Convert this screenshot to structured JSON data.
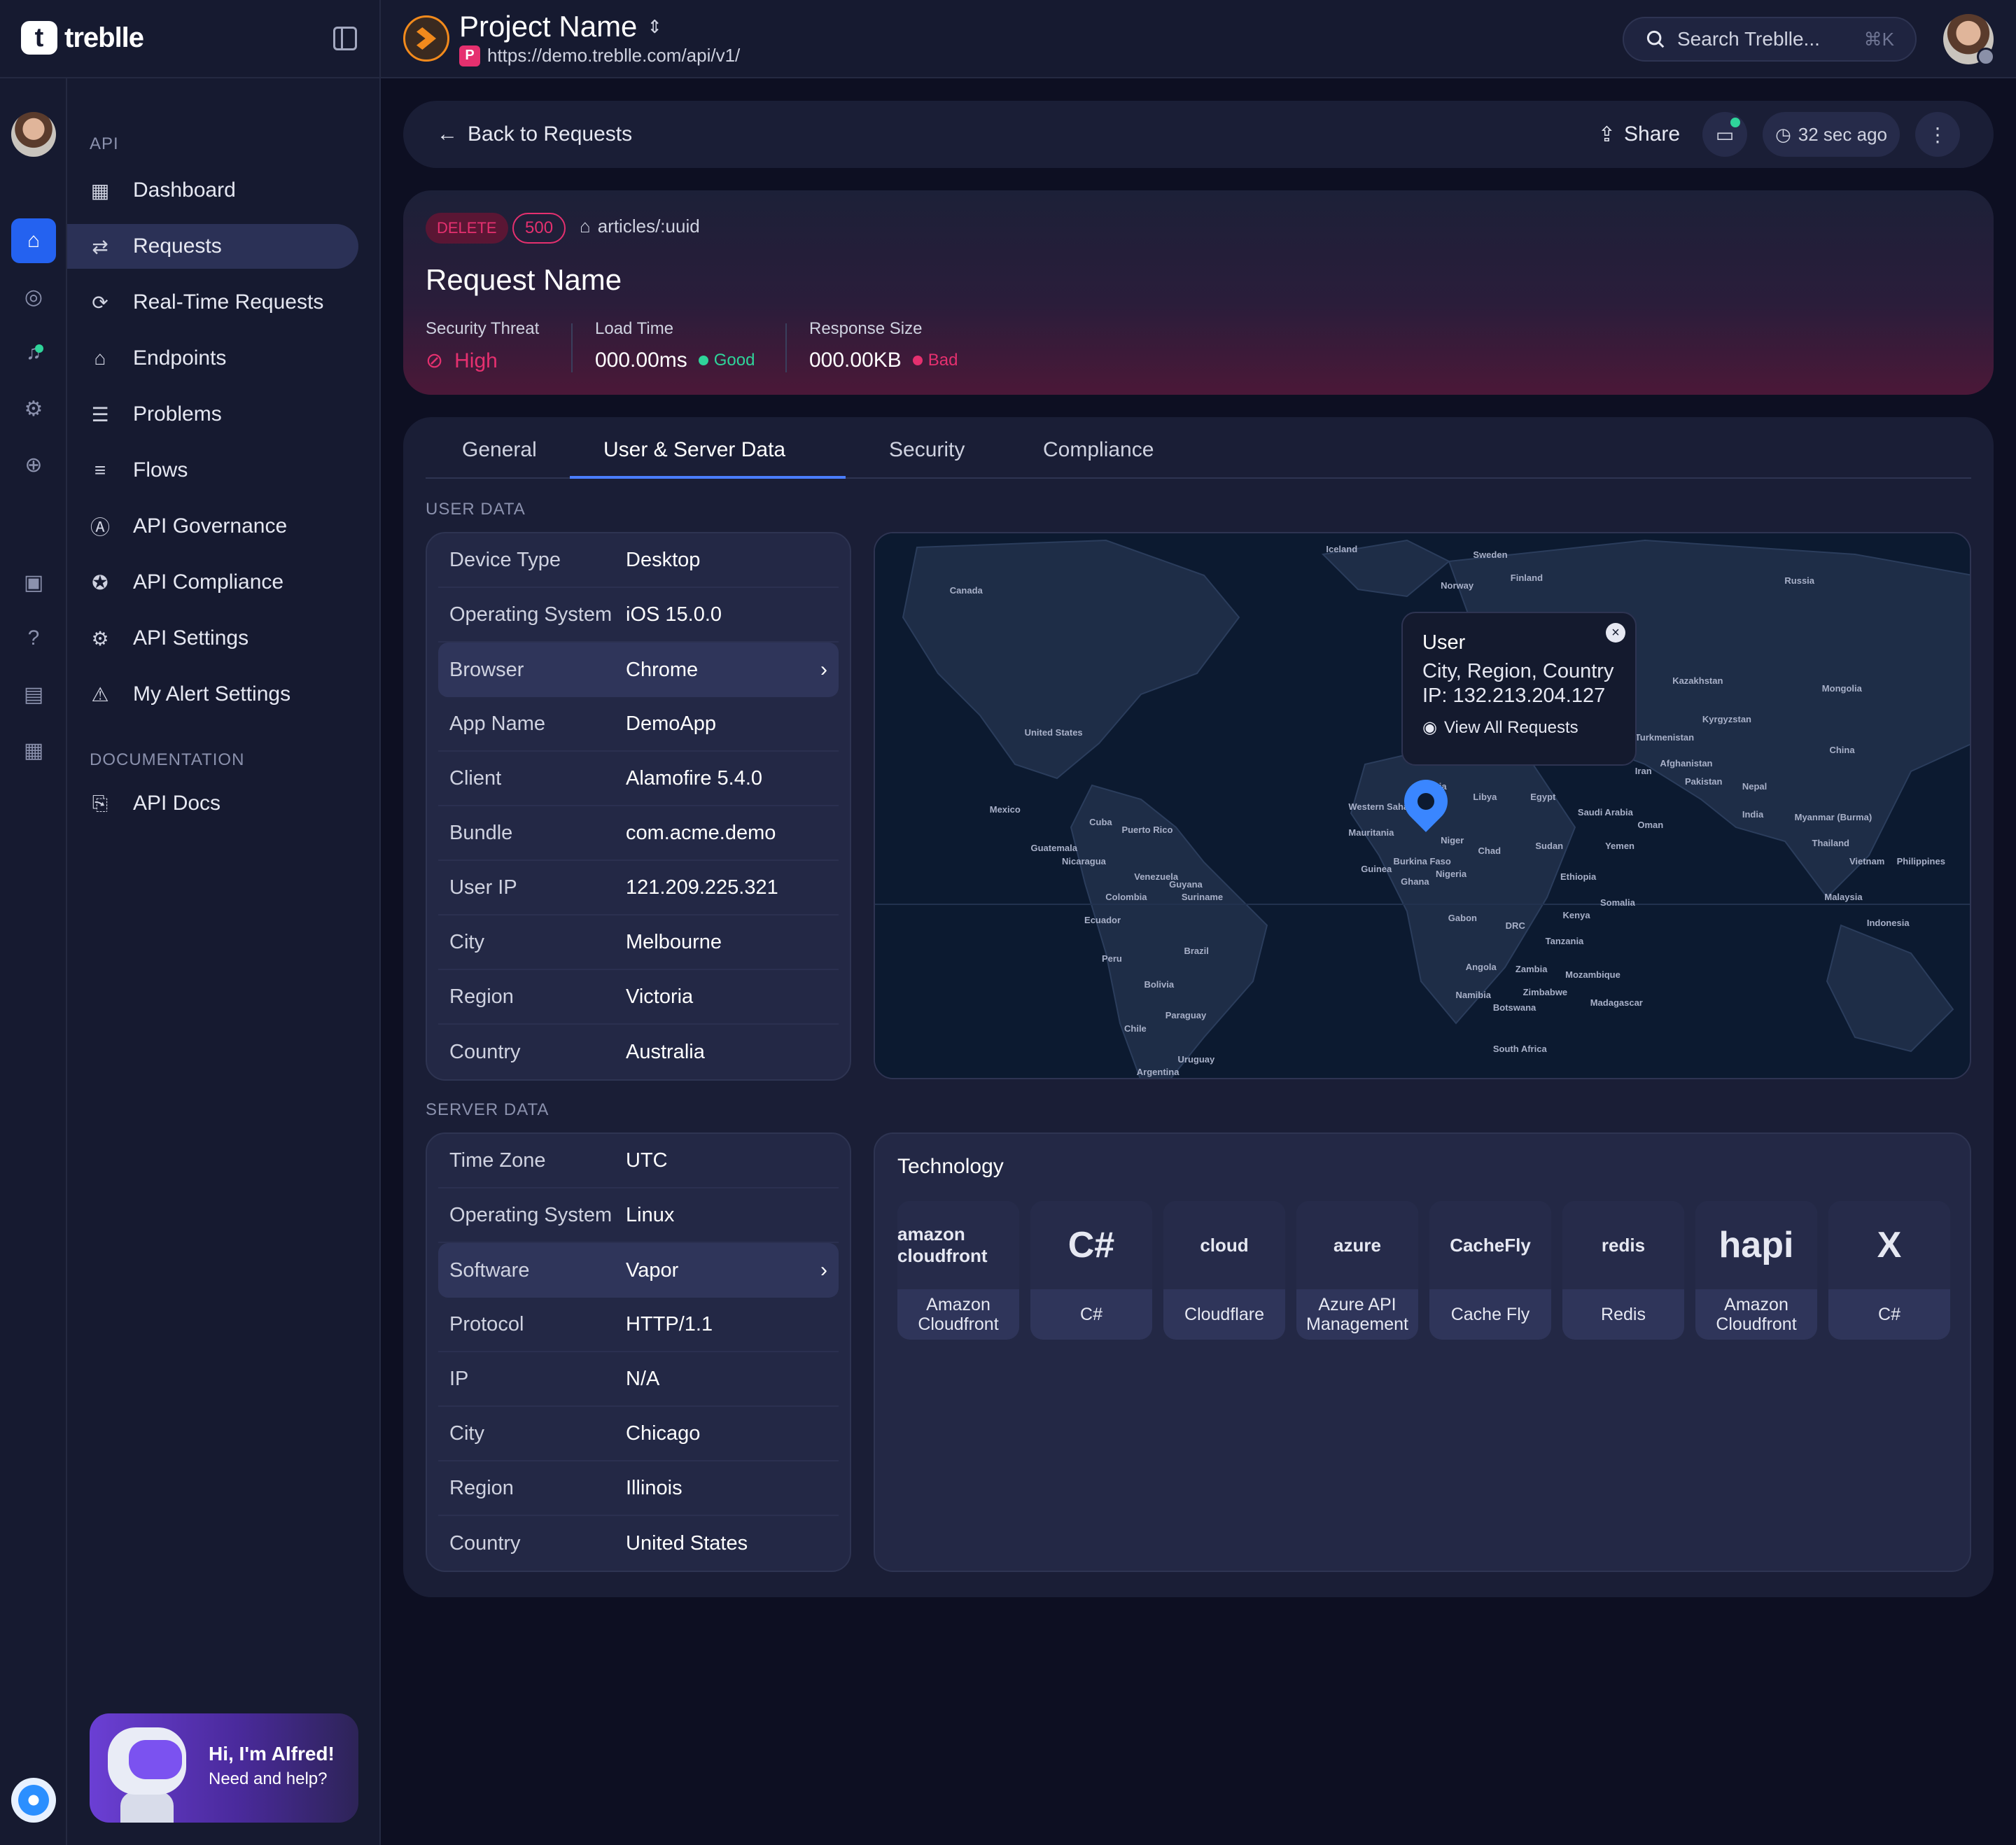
{
  "brand": {
    "logo_text": "treblle"
  },
  "project": {
    "name": "Project Name",
    "url": "https://demo.treblle.com/api/v1/",
    "url_badge": "P"
  },
  "search": {
    "placeholder": "Search Treblle...",
    "shortcut": "⌘K"
  },
  "sidebar": {
    "api_section": "API",
    "items": [
      {
        "label": "Dashboard",
        "icon": "grid-icon"
      },
      {
        "label": "Requests",
        "icon": "arrows-icon",
        "active": true
      },
      {
        "label": "Real-Time Requests",
        "icon": "realtime-icon"
      },
      {
        "label": "Endpoints",
        "icon": "endpoint-icon"
      },
      {
        "label": "Problems",
        "icon": "problems-icon"
      },
      {
        "label": "Flows",
        "icon": "flows-icon"
      },
      {
        "label": "API Governance",
        "icon": "governance-icon"
      },
      {
        "label": "API Compliance",
        "icon": "compliance-icon"
      },
      {
        "label": "API Settings",
        "icon": "gear-icon"
      },
      {
        "label": "My Alert Settings",
        "icon": "warning-icon"
      }
    ],
    "docs_section": "DOCUMENTATION",
    "docs_items": [
      {
        "label": "API Docs",
        "icon": "docs-icon"
      }
    ],
    "alfred": {
      "title": "Hi, I'm Alfred!",
      "subtitle": "Need and help?"
    }
  },
  "header": {
    "back_label": "Back to Requests",
    "share_label": "Share",
    "time_label": "32 sec ago"
  },
  "request": {
    "method": "DELETE",
    "status": "500",
    "route": "articles/:uuid",
    "title": "Request Name",
    "security_label": "Security Threat",
    "security_value": "High",
    "load_label": "Load Time",
    "load_value": "000.00ms",
    "load_status": "Good",
    "size_label": "Response Size",
    "size_value": "000.00KB",
    "size_status": "Bad"
  },
  "tabs": [
    "General",
    "User & Server Data",
    "Security",
    "Compliance"
  ],
  "active_tab": "User & Server Data",
  "user_data": {
    "title": "USER DATA",
    "rows": [
      {
        "k": "Device Type",
        "v": "Desktop"
      },
      {
        "k": "Operating System",
        "v": "iOS 15.0.0"
      },
      {
        "k": "Browser",
        "v": "Chrome"
      },
      {
        "k": "App Name",
        "v": "DemoApp"
      },
      {
        "k": "Client",
        "v": "Alamofire 5.4.0"
      },
      {
        "k": "Bundle",
        "v": "com.acme.demo"
      },
      {
        "k": "User IP",
        "v": "121.209.225.321"
      },
      {
        "k": "City",
        "v": "Melbourne"
      },
      {
        "k": "Region",
        "v": "Victoria"
      },
      {
        "k": "Country",
        "v": "Australia"
      }
    ]
  },
  "server_data": {
    "title": "SERVER DATA",
    "rows": [
      {
        "k": "Time Zone",
        "v": "UTC"
      },
      {
        "k": "Operating System",
        "v": "Linux"
      },
      {
        "k": "Software",
        "v": "Vapor"
      },
      {
        "k": "Protocol",
        "v": "HTTP/1.1"
      },
      {
        "k": "IP",
        "v": "N/A"
      },
      {
        "k": "City",
        "v": "Chicago"
      },
      {
        "k": "Region",
        "v": "Illinois"
      },
      {
        "k": "Country",
        "v": "United States"
      }
    ]
  },
  "map_tooltip": {
    "title": "User",
    "location": "City, Region, Country",
    "ip": "IP: 132.213.204.127",
    "link": "View All Requests"
  },
  "map_labels": [
    "Canada",
    "United States",
    "Mexico",
    "Cuba",
    "Puerto Rico",
    "Guatemala",
    "Nicaragua",
    "Venezuela",
    "Colombia",
    "Ecuador",
    "Peru",
    "Brazil",
    "Bolivia",
    "Chile",
    "Paraguay",
    "Uruguay",
    "Argentina",
    "Guyana",
    "Suriname",
    "Iceland",
    "Sweden",
    "Finland",
    "Norway",
    "Russia",
    "Kazakhstan",
    "Mongolia",
    "China",
    "Kyrgyzstan",
    "Turkmenistan",
    "Afghanistan",
    "Iran",
    "Pakistan",
    "Nepal",
    "India",
    "Myanmar (Burma)",
    "Thailand",
    "Vietnam",
    "Philippines",
    "Malaysia",
    "Indonesia",
    "Algeria",
    "Libya",
    "Egypt",
    "Saudi Arabia",
    "Oman",
    "Yemen",
    "Sudan",
    "Chad",
    "Niger",
    "Nigeria",
    "Ethiopia",
    "Somalia",
    "Kenya",
    "Tanzania",
    "DRC",
    "Gabon",
    "Angola",
    "Zambia",
    "Mozambique",
    "Zimbabwe",
    "Namibia",
    "Botswana",
    "Madagascar",
    "South Africa",
    "Western Sahara",
    "Mauritania",
    "Guinea",
    "Burkina Faso",
    "Ghana"
  ],
  "technology": {
    "title": "Technology",
    "items": [
      {
        "name": "Amazon Cloudfront",
        "logo": "amazon cloudfront"
      },
      {
        "name": "C#",
        "logo": "C#"
      },
      {
        "name": "Cloudflare",
        "logo": "cloud"
      },
      {
        "name": "Azure API Management",
        "logo": "azure"
      },
      {
        "name": "Cache Fly",
        "logo": "CacheFly"
      },
      {
        "name": "Redis",
        "logo": "redis"
      },
      {
        "name": "Amazon Cloudfront",
        "logo": "hapi"
      },
      {
        "name": "C#",
        "logo": "X"
      }
    ]
  }
}
